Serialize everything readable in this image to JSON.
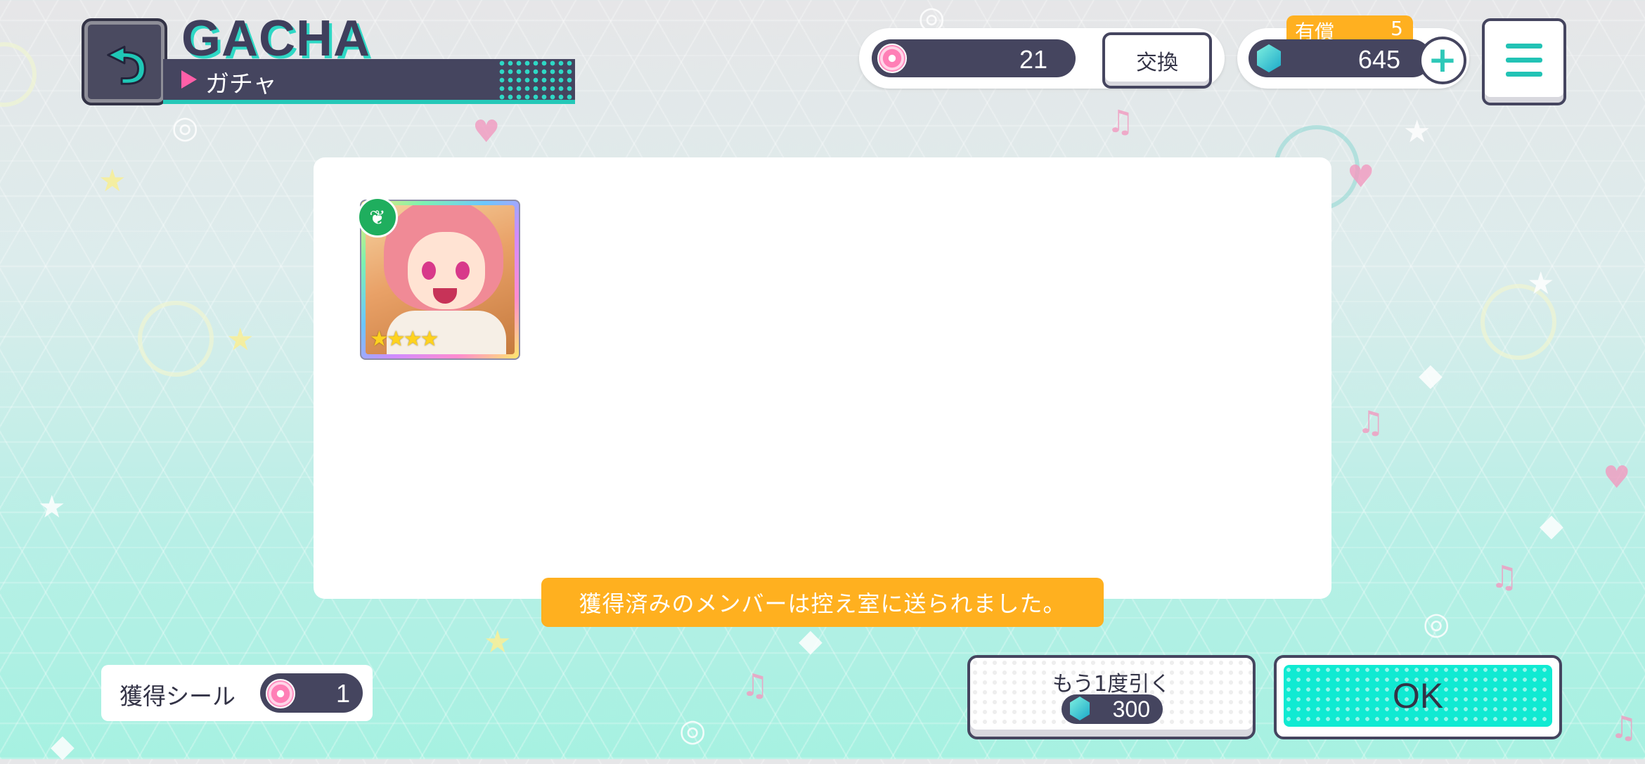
{
  "header": {
    "back_icon": "undo-arrow-icon",
    "title": "GACHA",
    "subtitle": "ガチャ"
  },
  "currency": {
    "seals": {
      "icon": "seal-disc-icon",
      "value": "21"
    },
    "exchange_label": "交換",
    "gems": {
      "icon": "crystal-gem-icon",
      "value": "645",
      "paid_label": "有償",
      "paid_value": "5"
    },
    "plus_label": "+",
    "menu_icon": "hamburger-menu-icon"
  },
  "result": {
    "card": {
      "rarity_stars": "★★★★",
      "attribute_icon": "sprout-icon"
    },
    "notice": "獲得済みのメンバーは控え室に送られました。"
  },
  "footer": {
    "seal_label": "獲得シール",
    "seal_value": "1",
    "pull_again_label": "もう1度引く",
    "pull_again_cost": "300",
    "ok_label": "OK"
  },
  "colors": {
    "accent": "#10ead2",
    "navy": "#45455f",
    "notice": "#ffb01f",
    "pink": "#ff5fa8"
  }
}
